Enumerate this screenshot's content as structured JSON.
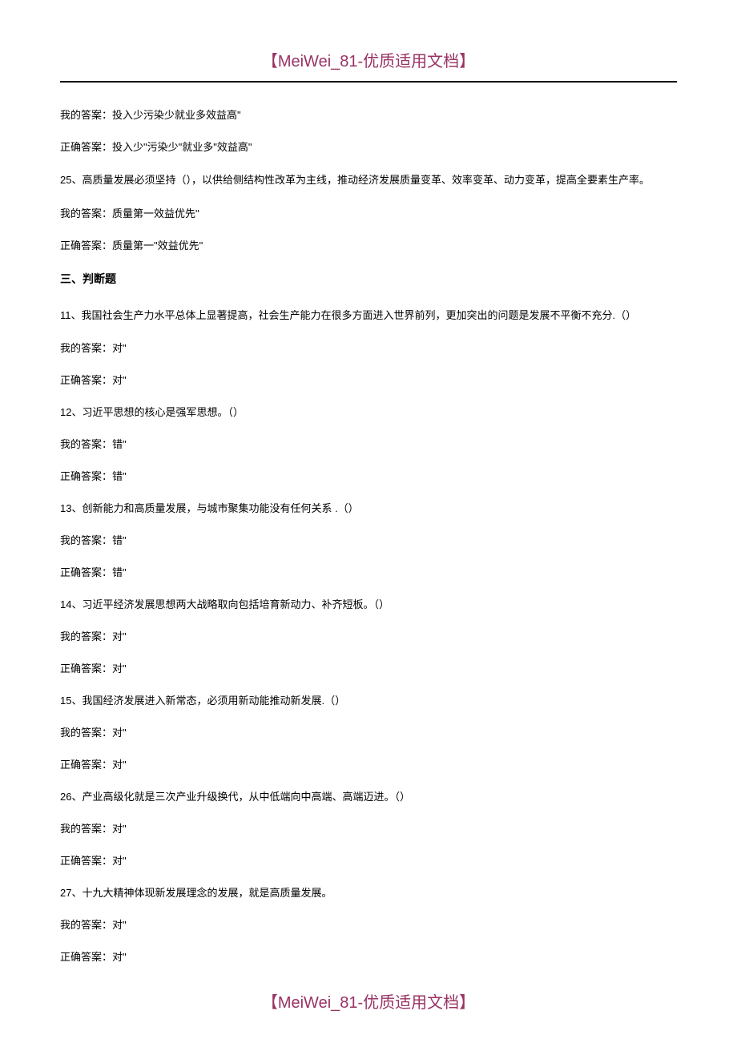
{
  "header": "【MeiWei_81-优质适用文档】",
  "footer": "【MeiWei_81-优质适用文档】",
  "sectionTitle": "三、判断题",
  "lines": [
    {
      "type": "line",
      "text": "我的答案：投入少污染少就业多效益高\""
    },
    {
      "type": "line",
      "text": "正确答案：投入少\"污染少\"就业多\"效益高\""
    },
    {
      "type": "question",
      "text": "25、高质量发展必须坚持（），以供给侧结构性改革为主线，推动经济发展质量变革、效率变革、动力变革，提高全要素生产率。"
    },
    {
      "type": "line",
      "text": "我的答案：质量第一效益优先\""
    },
    {
      "type": "line",
      "text": "正确答案：质量第一\"效益优先\""
    },
    {
      "type": "section"
    },
    {
      "type": "question",
      "text": "11、我国社会生产力水平总体上显著提高，社会生产能力在很多方面进入世界前列，更加突出的问题是发展不平衡不充分.（）"
    },
    {
      "type": "line",
      "text": "我的答案：对\""
    },
    {
      "type": "line",
      "text": "正确答案：对\""
    },
    {
      "type": "line",
      "text": "12、习近平思想的核心是强军思想。（）"
    },
    {
      "type": "line",
      "text": "我的答案：错\""
    },
    {
      "type": "line",
      "text": "正确答案：错\""
    },
    {
      "type": "line",
      "text": "13、创新能力和高质量发展，与城市聚集功能没有任何关系 .（）"
    },
    {
      "type": "line",
      "text": "我的答案：错\""
    },
    {
      "type": "line",
      "text": "正确答案：错\""
    },
    {
      "type": "line",
      "text": "14、习近平经济发展思想两大战略取向包括培育新动力、补齐短板。（）"
    },
    {
      "type": "line",
      "text": "我的答案：对\""
    },
    {
      "type": "line",
      "text": "正确答案：对\""
    },
    {
      "type": "line",
      "text": "15、我国经济发展进入新常态，必须用新动能推动新发展.（）"
    },
    {
      "type": "line",
      "text": "我的答案：对\""
    },
    {
      "type": "line",
      "text": "正确答案：对\""
    },
    {
      "type": "line",
      "text": "26、产业高级化就是三次产业升级换代，从中低端向中高端、高端迈进。（）"
    },
    {
      "type": "line",
      "text": "我的答案：对\""
    },
    {
      "type": "line",
      "text": "正确答案：对\""
    },
    {
      "type": "line",
      "text": "27、十九大精神体现新发展理念的发展，就是高质量发展。"
    },
    {
      "type": "line",
      "text": "我的答案：对\""
    },
    {
      "type": "line",
      "text": "正确答案：对\""
    }
  ]
}
